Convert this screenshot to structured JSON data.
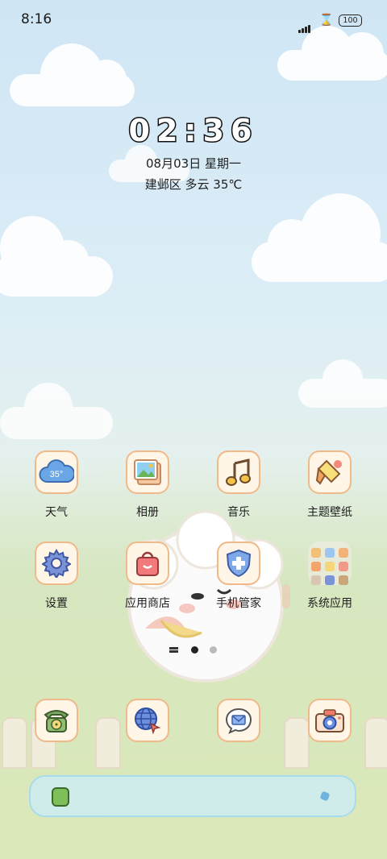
{
  "status_bar": {
    "time": "8:16",
    "battery": "100"
  },
  "lock": {
    "clock": "02:36",
    "date": "08月03日 星期一",
    "weather": "建邺区 多云 35℃"
  },
  "apps": [
    {
      "label": "天气",
      "icon": "weather-cloud-icon",
      "badge": "35°"
    },
    {
      "label": "相册",
      "icon": "photo-frame-icon"
    },
    {
      "label": "音乐",
      "icon": "music-note-icon"
    },
    {
      "label": "主题壁纸",
      "icon": "paint-brush-icon"
    },
    {
      "label": "设置",
      "icon": "gear-icon"
    },
    {
      "label": "应用商店",
      "icon": "shopping-bag-icon"
    },
    {
      "label": "手机管家",
      "icon": "shield-plus-icon"
    },
    {
      "label": "系统应用",
      "icon": "folder-icon"
    }
  ],
  "dock": [
    {
      "icon": "rotary-phone-icon"
    },
    {
      "icon": "globe-browser-icon"
    },
    {
      "icon": "message-mail-icon"
    },
    {
      "icon": "camera-icon"
    }
  ],
  "page_indicator": {
    "pages": 2,
    "current": 1
  },
  "colors": {
    "icon_border": "#f0b98a",
    "icon_bg": "#fff6e8",
    "search_bar": "#a9dcea"
  }
}
